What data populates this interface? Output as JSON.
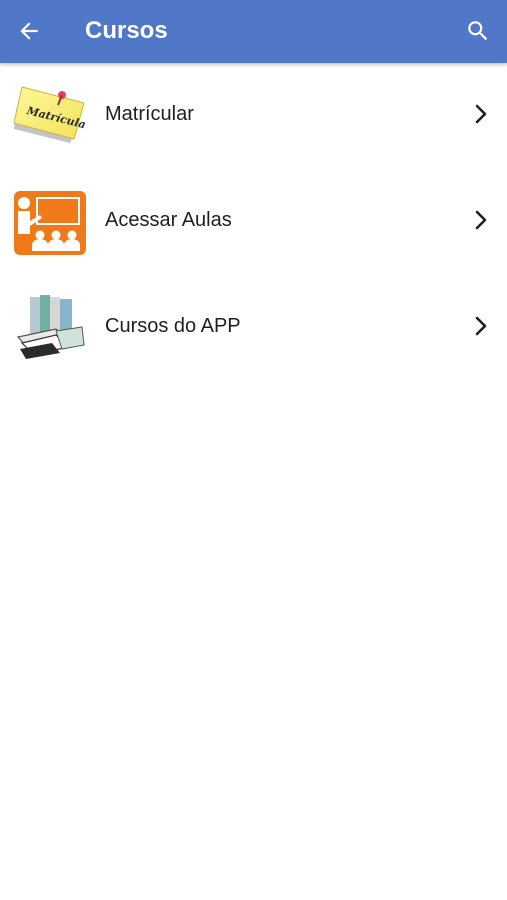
{
  "appbar": {
    "title": "Cursos",
    "back_icon": "arrow-left-icon",
    "search_icon": "search-icon",
    "color": "#5177c8"
  },
  "menu": {
    "items": [
      {
        "label": "Matrícular",
        "icon": "sticky-note-icon",
        "icon_text": "Matrícula"
      },
      {
        "label": "Acessar Aulas",
        "icon": "classroom-presentation-icon"
      },
      {
        "label": "Cursos do APP",
        "icon": "books-binders-icon"
      }
    ]
  }
}
